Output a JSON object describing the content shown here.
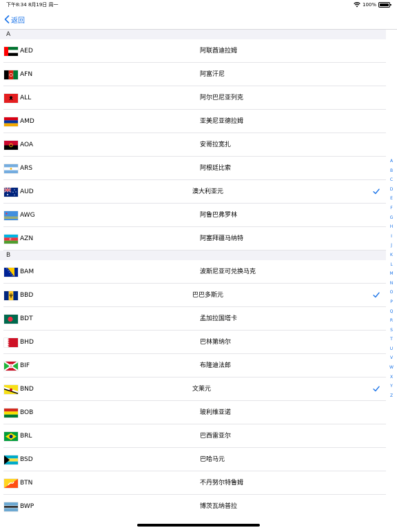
{
  "status_bar": {
    "time_date": "下午8:34  8月19日 周一",
    "battery": "100%"
  },
  "nav": {
    "back_label": "返回"
  },
  "sections": [
    {
      "letter": "A",
      "rows": [
        {
          "code": "AED",
          "name": "阿联酋迪拉姆",
          "checked": false
        },
        {
          "code": "AFN",
          "name": "阿富汗尼",
          "checked": false
        },
        {
          "code": "ALL",
          "name": "阿尔巴尼亚列克",
          "checked": false
        },
        {
          "code": "AMD",
          "name": "亚美尼亚德拉姆",
          "checked": false
        },
        {
          "code": "AOA",
          "name": "安哥拉宽扎",
          "checked": false
        },
        {
          "code": "ARS",
          "name": "阿根廷比索",
          "checked": false
        },
        {
          "code": "AUD",
          "name": "澳大利亚元",
          "checked": true
        },
        {
          "code": "AWG",
          "name": "阿鲁巴弗罗林",
          "checked": false
        },
        {
          "code": "AZN",
          "name": "阿塞拜疆马纳特",
          "checked": false
        }
      ]
    },
    {
      "letter": "B",
      "rows": [
        {
          "code": "BAM",
          "name": "波斯尼亚可兑换马克",
          "checked": false
        },
        {
          "code": "BBD",
          "name": "巴巴多斯元",
          "checked": true
        },
        {
          "code": "BDT",
          "name": "孟加拉国塔卡",
          "checked": false
        },
        {
          "code": "BHD",
          "name": "巴林第纳尔",
          "checked": false
        },
        {
          "code": "BIF",
          "name": "布隆迪法郎",
          "checked": false
        },
        {
          "code": "BND",
          "name": "文莱元",
          "checked": true
        },
        {
          "code": "BOB",
          "name": "玻利维亚诺",
          "checked": false
        },
        {
          "code": "BRL",
          "name": "巴西雷亚尔",
          "checked": false
        },
        {
          "code": "BSD",
          "name": "巴哈马元",
          "checked": false
        },
        {
          "code": "BTN",
          "name": "不丹努尔特鲁姆",
          "checked": false
        },
        {
          "code": "BWP",
          "name": "博茨瓦纳普拉",
          "checked": false
        }
      ]
    }
  ],
  "index_letters": [
    "A",
    "B",
    "C",
    "D",
    "E",
    "F",
    "G",
    "H",
    "I",
    "J",
    "K",
    "L",
    "M",
    "N",
    "O",
    "P",
    "Q",
    "R",
    "S",
    "T",
    "U",
    "V",
    "W",
    "X",
    "Y",
    "Z"
  ],
  "colors": {
    "accent": "#1a73e8",
    "section_bg": "#f2f2f7"
  }
}
